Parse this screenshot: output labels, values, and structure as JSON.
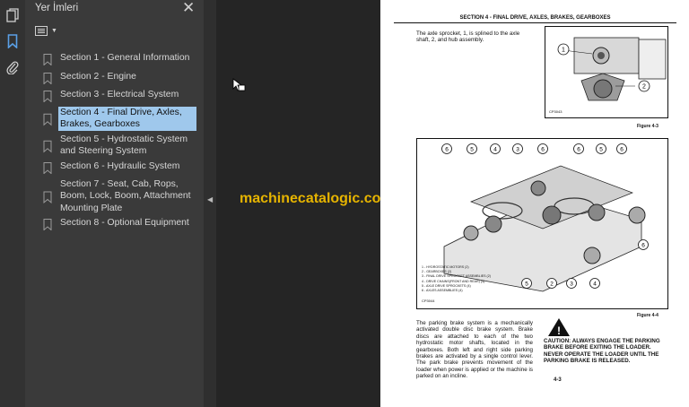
{
  "sidebar": {
    "title": "Yer İmleri",
    "bookmarks": [
      {
        "label": "Section 1 - General Information"
      },
      {
        "label": "Section 2 - Engine"
      },
      {
        "label": "Section 3 - Electrical System"
      },
      {
        "label": "Section 4 - Final Drive, Axles, Brakes, Gearboxes"
      },
      {
        "label": "Section 5 - Hydrostatic System and Steering System"
      },
      {
        "label": "Section 6 - Hydraulic System"
      },
      {
        "label": "Section 7 - Seat, Cab, Rops, Boom, Lock, Boom, Attachment Mounting Plate"
      },
      {
        "label": "Section 8 - Optional Equipment"
      }
    ],
    "selected_index": 3
  },
  "watermark": "machinecatalogic.com",
  "page": {
    "header": "SECTION 4 - FINAL DRIVE, AXLES, BRAKES, GEARBOXES",
    "intro": "The axle sprocket, 1, is splined to the axle shaft, 2, and hub assembly.",
    "fig3_code": "CP3043",
    "fig3_caption": "Figure 4-3",
    "callouts_top": [
      "6",
      "5",
      "4",
      "3",
      "6",
      "6",
      "5",
      "6"
    ],
    "callouts_bottom": [
      "5",
      "2",
      "3",
      "4",
      "6"
    ],
    "legend": [
      "1 - HYDROSTATIC MOTORS (2)",
      "2 - GEARBOXES (2)",
      "3 - FINAL DRIVE SPROCKET ASSEMBLIES (2)",
      "4 - DRIVE CHAINS(FRONT AND REAR) (4)",
      "5 - AXLE DRIVE SPROCKETS (4)",
      "6 - AXLES ASSEMBLIES (4)"
    ],
    "fig4_code": "CP3044",
    "fig4_caption": "Figure 4-4",
    "brake_text": "The parking brake system is a mechanically activated double disc brake system. Brake discs are attached to each of the two hydrostatic motor shafts, located in the gearboxes. Both left and right side parking brakes are activated by a single control lever. The park brake prevents movement of the loader when power is applied or the machine is parked on an incline.",
    "caution": "CAUTION: ALWAYS ENGAGE THE PARKING BRAKE BEFORE EXITING THE LOADER. NEVER OPERATE THE LOADER UNTIL THE PARKING BRAKE IS RELEASED.",
    "page_number": "4-3"
  },
  "icons": [
    "pages-icon",
    "bookmark-icon",
    "attachment-icon",
    "close-icon",
    "options-icon",
    "collapse-arrow-icon",
    "cursor-icon"
  ]
}
